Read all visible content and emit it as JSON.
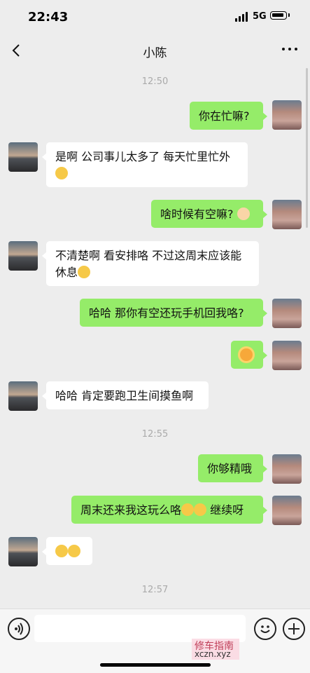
{
  "status_bar": {
    "time": "22:43",
    "network": "5G"
  },
  "header": {
    "title": "小陈"
  },
  "timestamps": [
    "12:50",
    "12:55",
    "12:57"
  ],
  "messages": [
    {
      "side": "me",
      "text": "你在忙嘛?"
    },
    {
      "side": "other",
      "lines": [
        "是啊 公司事儿太多了 每天忙里忙外",
        ""
      ],
      "emoji": "laughing-crying"
    },
    {
      "side": "me",
      "text": "啥时候有空嘛?",
      "emoji": "pleading"
    },
    {
      "side": "other",
      "lines": [
        "不清楚啊 看安排咯 不过这周末应该能",
        "休息"
      ],
      "emoji": "thinking"
    },
    {
      "side": "me",
      "text": "哈哈 那你有空还玩手机回我咯?"
    },
    {
      "side": "me",
      "text": "",
      "emoji": "sun"
    },
    {
      "side": "other",
      "text": "哈哈 肯定要跑卫生间摸鱼啊"
    },
    {
      "side": "me",
      "text": "你够精哦"
    },
    {
      "side": "me",
      "text_before": "周末还来我这玩么咯",
      "text_after": " 继续呀",
      "emoji": "flushed"
    },
    {
      "side": "other",
      "text": "",
      "emoji": "flushed"
    }
  ],
  "watermark": {
    "line1": "修车指南",
    "line2": "xczn.xyz"
  },
  "colors": {
    "me_bubble": "#95ec69",
    "other_bubble": "#ffffff",
    "background": "#ededed"
  }
}
